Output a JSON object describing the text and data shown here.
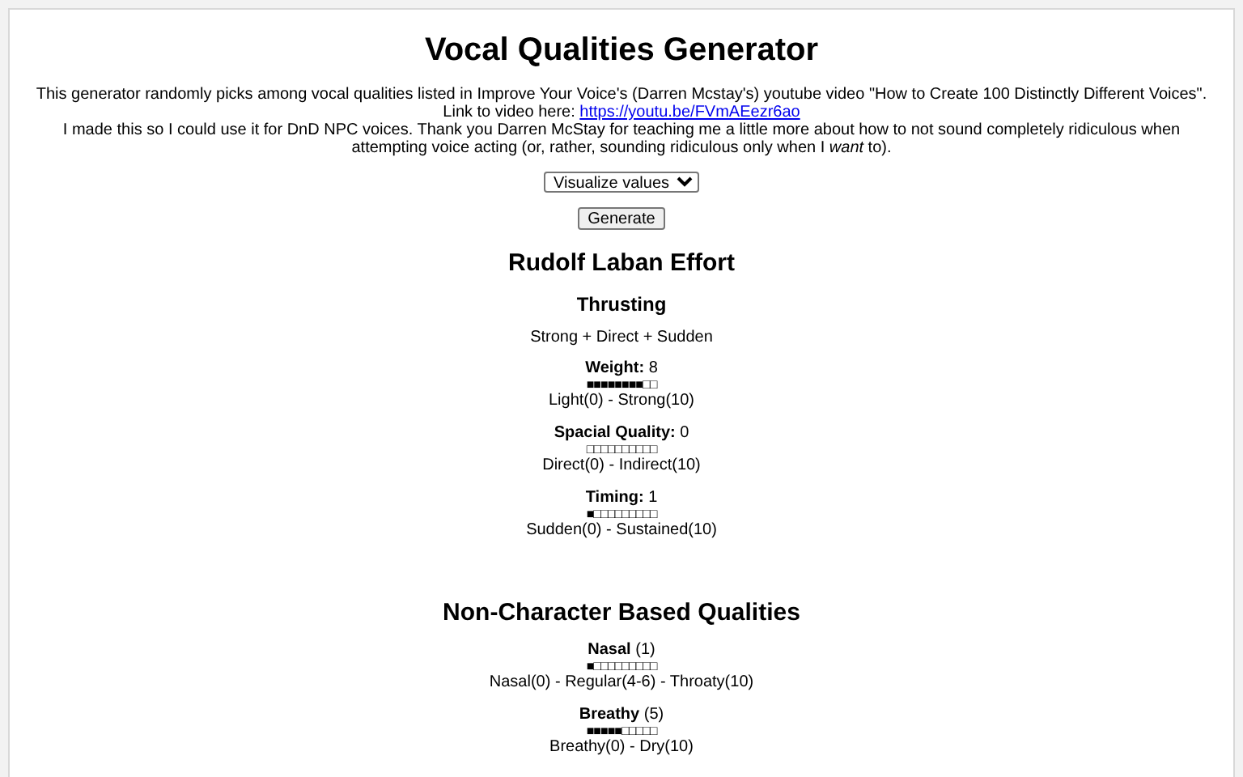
{
  "title": "Vocal Qualities Generator",
  "intro": {
    "line_1": "This generator randomly picks among vocal qualities listed in Improve Your Voice's (Darren Mcstay's) youtube video \"How to Create 100 Distinctly Different Voices\".",
    "link_label": "Link to video here: ",
    "link": "https://youtu.be/FVmAEezr6ao",
    "line_3": "I made this so I could use it for DnD NPC voices. Thank you Darren McStay for teaching me a little more about how to not sound completely ridiculous when attempting voice acting (or, rather, sounding ridiculous only when I *want* to)."
  },
  "select": {
    "value": "Visualize values"
  },
  "generate_button": "Generate",
  "sections": [
    {
      "heading": "Rudolf Laban Effort",
      "subheading": "Thrusting",
      "summary": "Strong + Direct + Sudden",
      "items": [
        {
          "name": "Weight:",
          "value": "8",
          "bar": "■■■■■■■■□□",
          "scale": "Light(0) - Strong(10)"
        },
        {
          "name": "Spacial Quality:",
          "value": "0",
          "bar": "□□□□□□□□□□",
          "scale": "Direct(0) - Indirect(10)"
        },
        {
          "name": "Timing:",
          "value": "1",
          "bar": "■□□□□□□□□□",
          "scale": "Sudden(0) - Sustained(10)"
        }
      ]
    },
    {
      "heading": "Non-Character Based Qualities",
      "items": [
        {
          "name": "Nasal",
          "value": "(1)",
          "bar": "■□□□□□□□□□",
          "scale": "Nasal(0) - Regular(4-6) - Throaty(10)"
        },
        {
          "name": "Breathy",
          "value": "(5)",
          "bar": "■■■■■□□□□□",
          "scale": "Breathy(0) - Dry(10)"
        }
      ]
    }
  ]
}
